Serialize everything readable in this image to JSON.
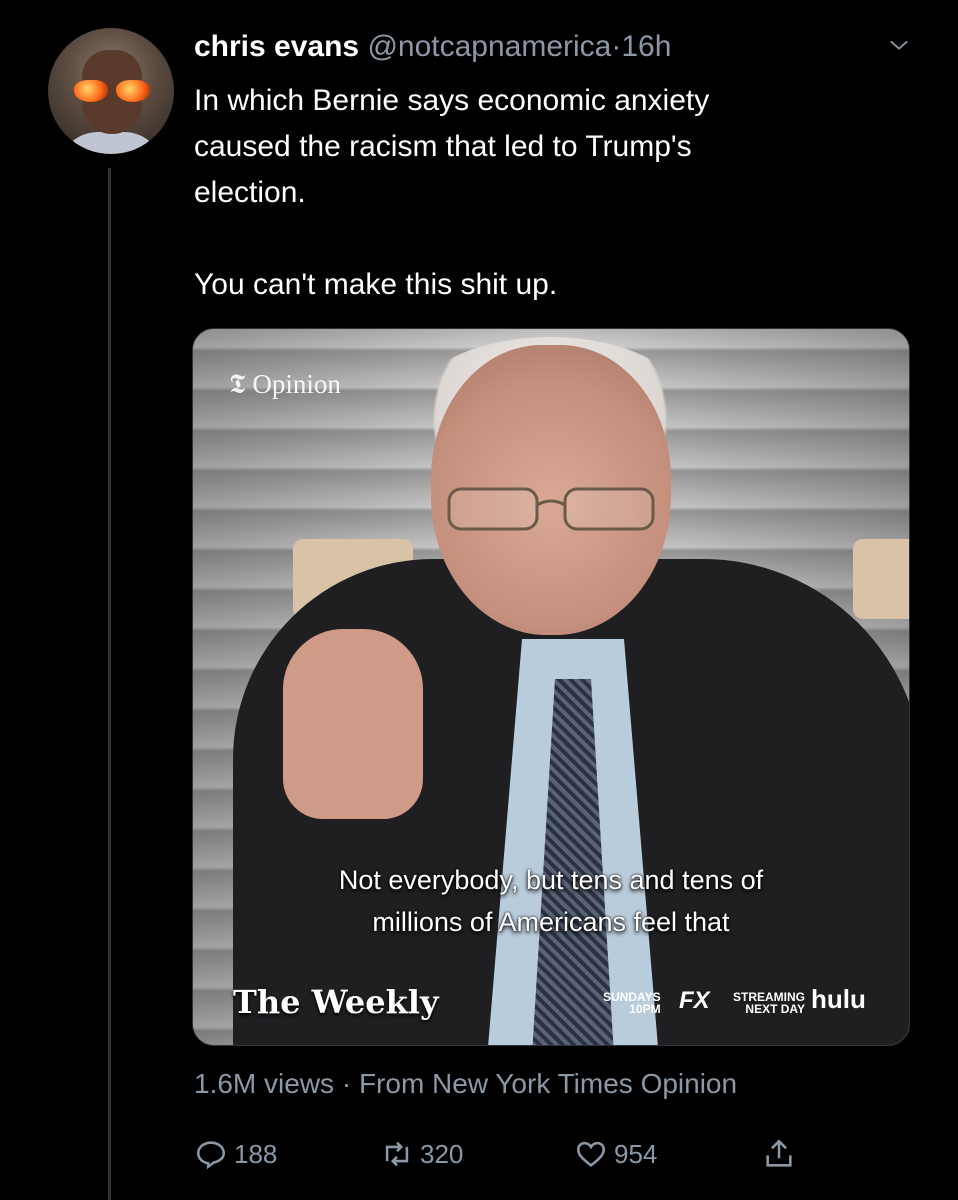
{
  "tweet": {
    "author_name": "chris evans",
    "handle": "@notcapnamerica",
    "separator": "·",
    "time": "16h",
    "text_lines": [
      "In which Bernie says economic anxiety",
      "caused the racism that led to Trump's",
      "election.",
      "You can't make this shit up."
    ],
    "avatar_icon": "avatar-icon",
    "menu_icon": "chevron-down-icon"
  },
  "media": {
    "watermark": "Opinion",
    "caption_lines": [
      "Not everybody, but tens and tens of",
      "millions of Americans feel that"
    ],
    "show_title": "The Weekly",
    "schedule_line1": "SUNDAYS",
    "schedule_line2": "10PM",
    "network": "FX",
    "streaming_line1": "STREAMING",
    "streaming_line2": "NEXT DAY",
    "platform": "hulu"
  },
  "meta": {
    "views": "1.6M views",
    "separator": "·",
    "source": "From New York Times Opinion"
  },
  "actions": {
    "replies": "188",
    "retweets": "320",
    "likes": "954"
  },
  "colors": {
    "background": "#000000",
    "text": "#ffffff",
    "secondary": "#8b98a5"
  }
}
